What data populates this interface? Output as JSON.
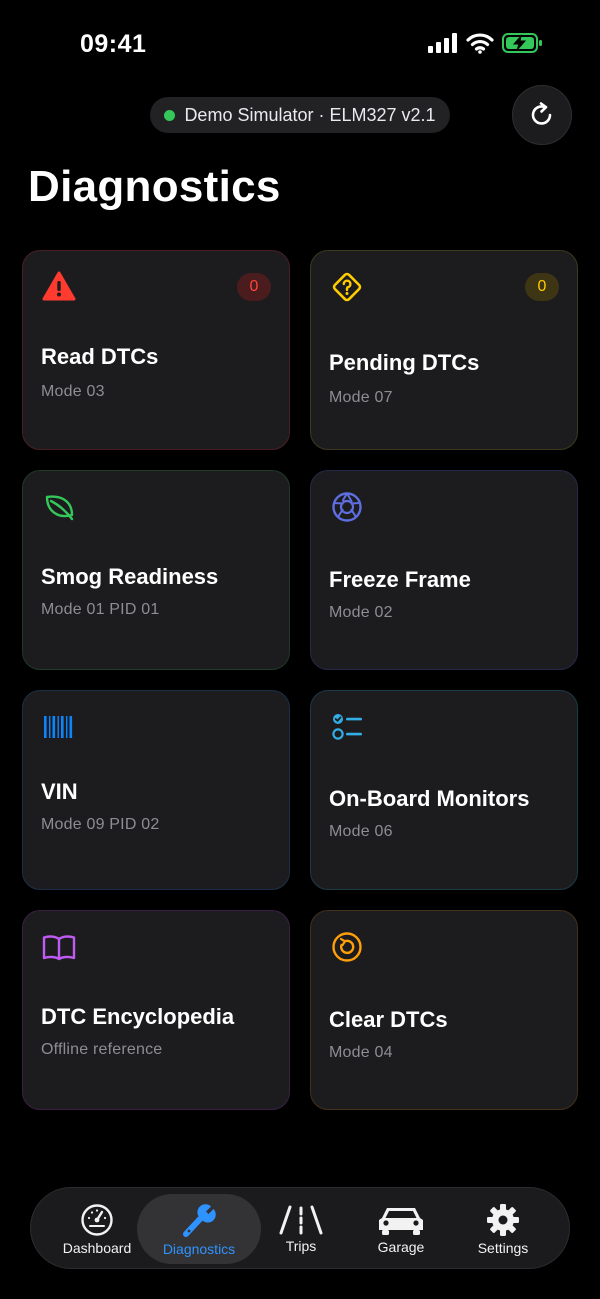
{
  "status_bar": {
    "time": "09:41"
  },
  "connection": {
    "label": "Demo Simulator · ELM327 v2.1",
    "status_color": "#34c759"
  },
  "refresh": {
    "icon": "refresh-icon"
  },
  "page": {
    "title": "Diagnostics"
  },
  "cards": [
    {
      "id": "read-dtcs",
      "label": "Read DTCs",
      "sub": "Mode 03",
      "icon": "warning-triangle-icon",
      "color": "#ff3b30",
      "badge": "0"
    },
    {
      "id": "pending-dtcs",
      "label": "Pending DTCs",
      "sub": "Mode 07",
      "icon": "question-diamond-icon",
      "color": "#ffcc00",
      "badge": "0"
    },
    {
      "id": "smog-readiness",
      "label": "Smog Readiness",
      "sub": "Mode 01 PID 01",
      "icon": "leaf-icon",
      "color": "#34c759"
    },
    {
      "id": "freeze-frame",
      "label": "Freeze Frame",
      "sub": "Mode 02",
      "icon": "camera-aperture-icon",
      "color": "#5e6ee0"
    },
    {
      "id": "vin",
      "label": "VIN",
      "sub": "Mode 09 PID 02",
      "icon": "barcode-icon",
      "color": "#0a84ff"
    },
    {
      "id": "onboard-monitors",
      "label": "On-Board Monitors",
      "sub": "Mode 06",
      "icon": "checklist-icon",
      "color": "#32ade6"
    },
    {
      "id": "dtc-encyclopedia",
      "label": "DTC Encyclopedia",
      "sub": "Offline reference",
      "icon": "book-icon",
      "color": "#bf5af2"
    },
    {
      "id": "clear-dtcs",
      "label": "Clear DTCs",
      "sub": "Mode 04",
      "icon": "reset-circle-icon",
      "color": "#ff9f0a"
    }
  ],
  "tabs": [
    {
      "label": "Dashboard",
      "icon": "gauge-icon",
      "active": false
    },
    {
      "label": "Diagnostics",
      "icon": "wrench-icon",
      "active": true
    },
    {
      "label": "Trips",
      "icon": "road-icon",
      "active": false
    },
    {
      "label": "Garage",
      "icon": "car-icon",
      "active": false
    },
    {
      "label": "Settings",
      "icon": "gear-icon",
      "active": false
    }
  ]
}
